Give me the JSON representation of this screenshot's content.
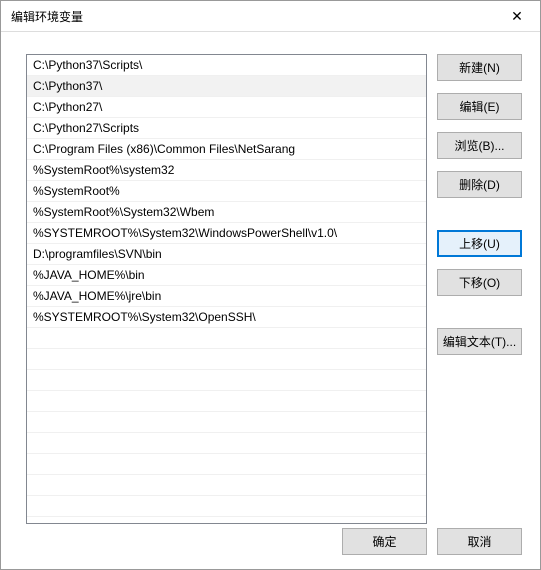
{
  "window": {
    "title": "编辑环境变量",
    "close_label": "✕"
  },
  "list": {
    "items": [
      "C:\\Python37\\Scripts\\",
      "C:\\Python37\\",
      "C:\\Python27\\",
      "C:\\Python27\\Scripts",
      "C:\\Program Files (x86)\\Common Files\\NetSarang",
      "%SystemRoot%\\system32",
      "%SystemRoot%",
      "%SystemRoot%\\System32\\Wbem",
      "%SYSTEMROOT%\\System32\\WindowsPowerShell\\v1.0\\",
      "D:\\programfiles\\SVN\\bin",
      "%JAVA_HOME%\\bin",
      "%JAVA_HOME%\\jre\\bin",
      "%SYSTEMROOT%\\System32\\OpenSSH\\"
    ],
    "selected_index": 1,
    "visible_rows": 22
  },
  "buttons": {
    "new": "新建(N)",
    "edit": "编辑(E)",
    "browse": "浏览(B)...",
    "delete": "删除(D)",
    "move_up": "上移(U)",
    "move_down": "下移(O)",
    "edit_text": "编辑文本(T)...",
    "ok": "确定",
    "cancel": "取消"
  }
}
